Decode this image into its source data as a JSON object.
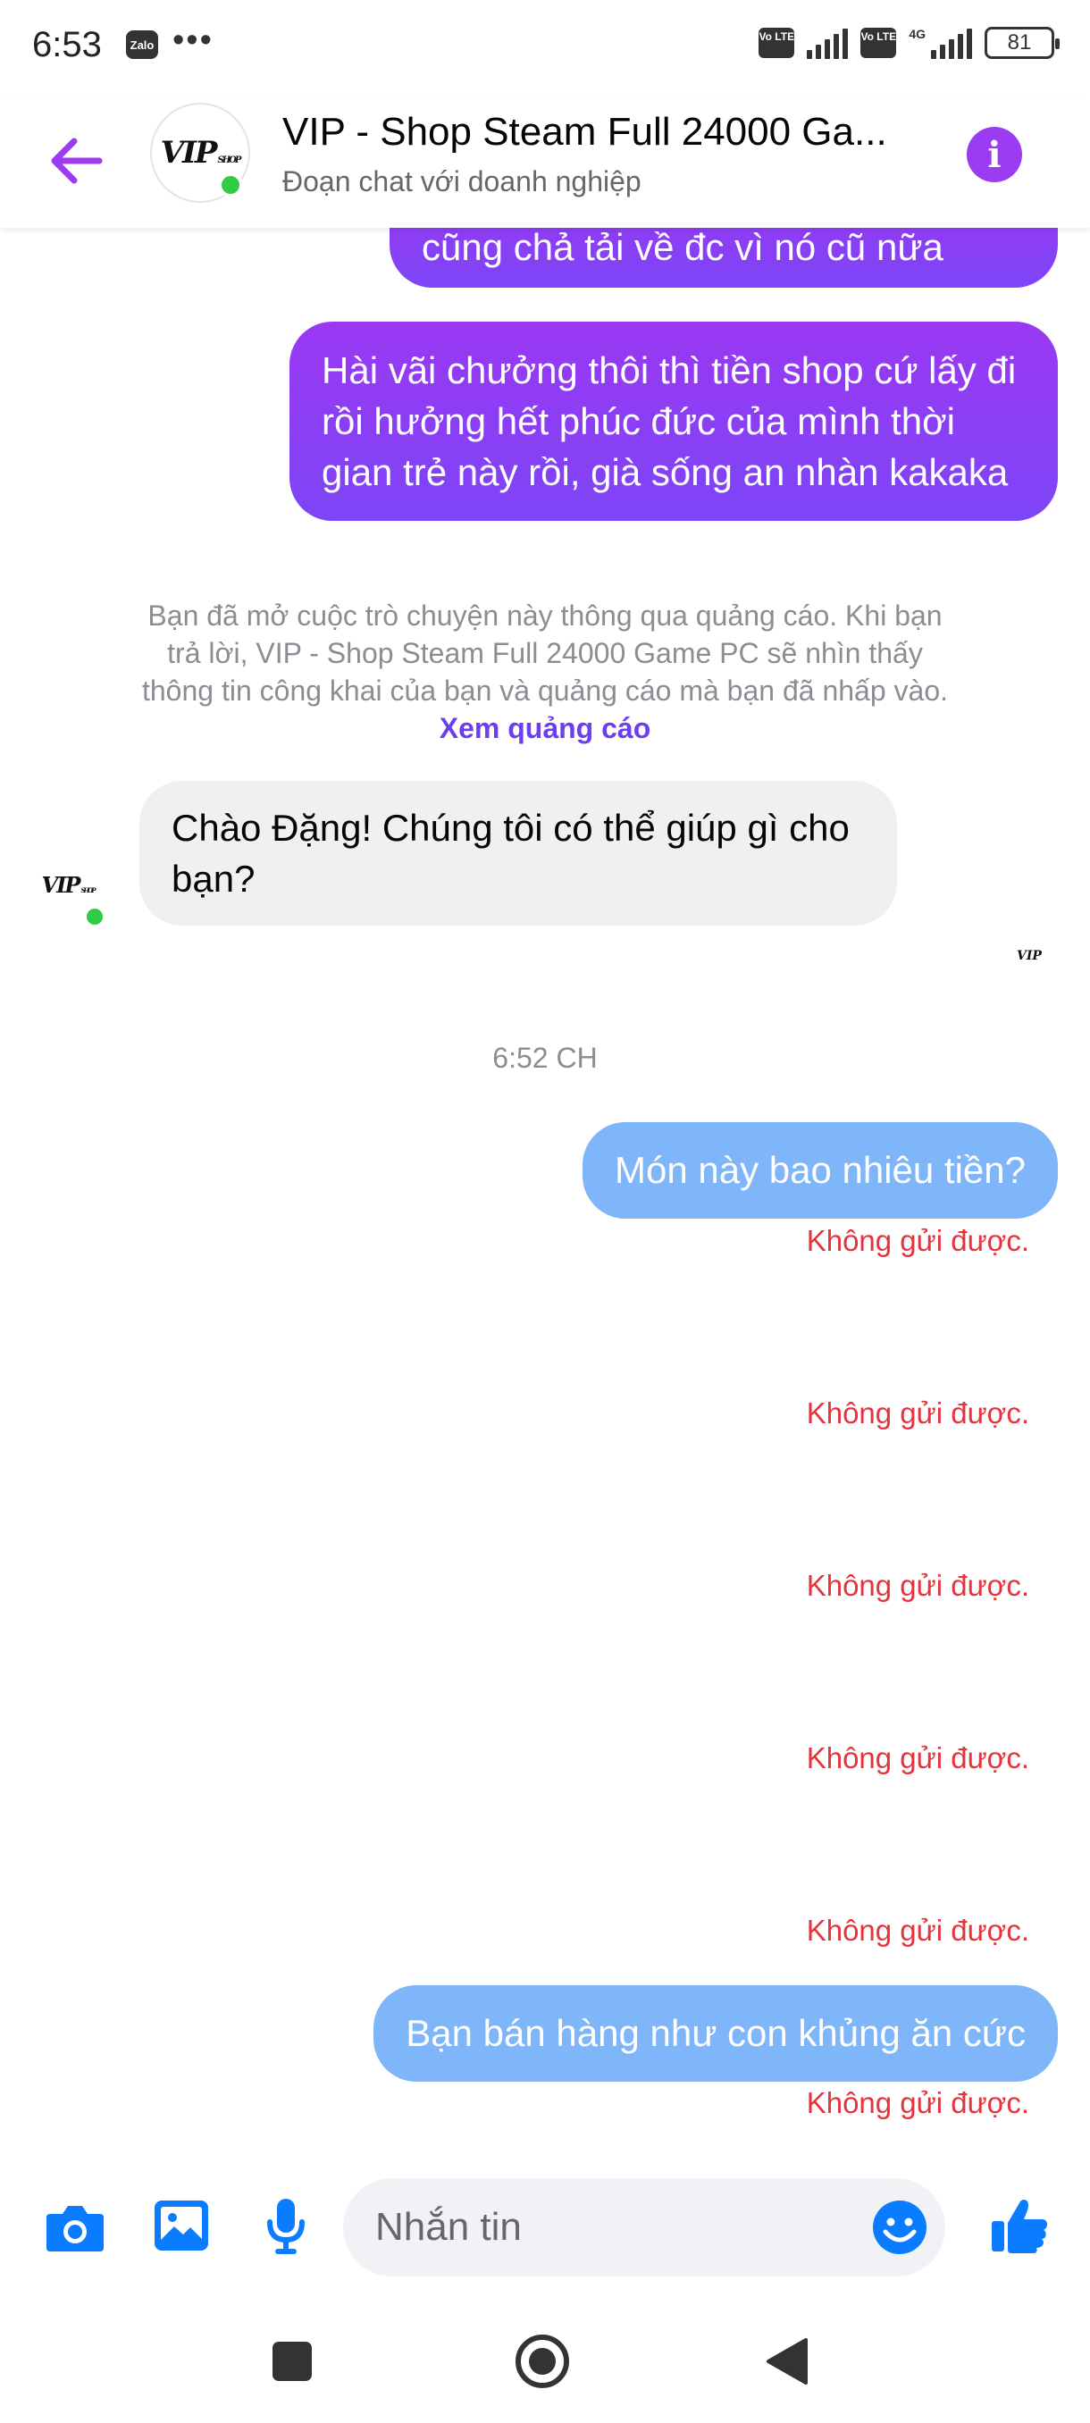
{
  "status_bar": {
    "time": "6:53",
    "zalo_label": "Zalo",
    "more": "•••",
    "volte": "Vo LTE",
    "network": "4G",
    "battery": "81"
  },
  "header": {
    "title": "VIP - Shop Steam Full 24000 Ga...",
    "subtitle": "Đoạn chat với doanh nghiệp",
    "logo_main": "VIP",
    "logo_small": "SHOP",
    "accent_color": "#9b3cf2"
  },
  "messages": {
    "partial_top": "cũng chả tải về đc vì nó cũ nữa",
    "outgoing_1": "Hài vãi chưởng thôi thì tiền shop cứ lấy đi rồi hưởng hết phúc đức của mình thời gian trẻ này rồi, già sống an nhàn kakaka",
    "ad_notice": "Bạn đã mở cuộc trò chuyện này thông qua quảng cáo. Khi bạn trả lời, VIP - Shop Steam Full 24000 Game PC sẽ nhìn thấy thông tin công khai của bạn và quảng cáo mà bạn đã nhấp vào.",
    "ad_link": "Xem quảng cáo",
    "incoming_1": "Chào Đặng! Chúng tôi có thể giúp gì cho bạn?",
    "timestamp": "6:52 CH",
    "outgoing_2": "Món này bao nhiêu tiền?",
    "outgoing_3": "Bạn bán hàng như con khủng ăn cức",
    "failed_label": "Không gửi được."
  },
  "composer": {
    "placeholder": "Nhắn tin"
  },
  "colors": {
    "messenger_blue": "#0a7cff",
    "failed_red": "#e5343d",
    "online_green": "#31cc46"
  }
}
